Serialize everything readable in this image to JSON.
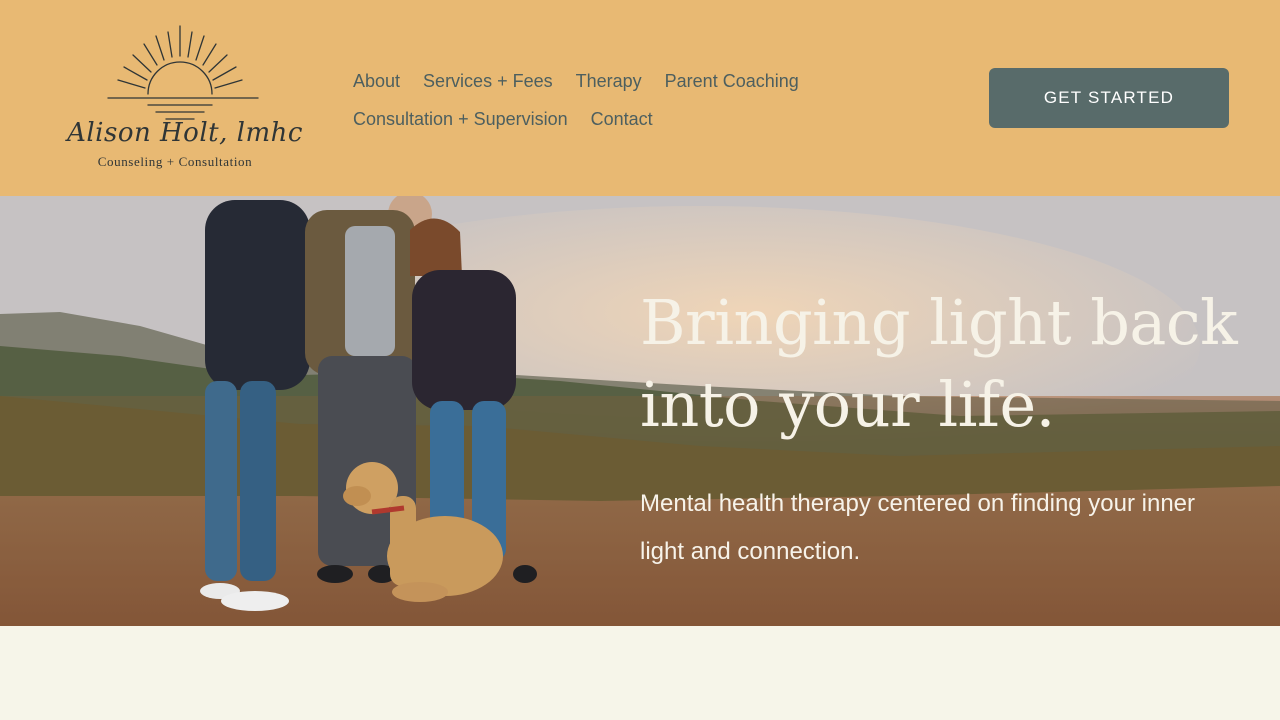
{
  "brand": {
    "name_script": "Alison Holt, lmhc",
    "tagline": "Counseling + Consultation"
  },
  "nav": {
    "row1": [
      "About",
      "Services + Fees",
      "Therapy",
      "Parent Coaching"
    ],
    "row2": [
      "Consultation + Supervision",
      "Contact"
    ]
  },
  "cta": {
    "label": "GET STARTED"
  },
  "hero": {
    "title_line1": "Bringing light back",
    "title_line2": "into your life.",
    "subtitle": "Mental health therapy centered on finding your inner light and connection."
  },
  "colors": {
    "header_bg": "#e8b973",
    "nav_text": "#4d5f5f",
    "cta_bg": "#586b6a",
    "page_bg": "#f6f5e9"
  }
}
